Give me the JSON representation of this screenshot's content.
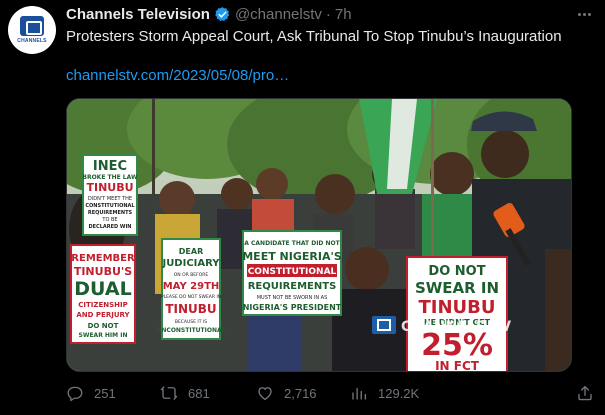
{
  "account": {
    "display_name": "Channels Television",
    "handle": "@channelstv",
    "separator": "·",
    "time": "7h",
    "avatar_label": "CHANNELS"
  },
  "tweet": {
    "text": "Protesters Storm Appeal Court, Ask Tribunal To Stop Tinubu’s Inauguration",
    "link": "channelstv.com/2023/05/08/pro…"
  },
  "media": {
    "watermark": "CHANNELS TV",
    "signs": {
      "inec": [
        "INEC",
        "BROKE THE LAW",
        "TINUBU",
        "DIDN'T MEET THE",
        "CONSTITUTIONAL",
        "REQUIREMENTS",
        "TO BE",
        "DECLARED WIN"
      ],
      "remember": [
        "REMEMBER",
        "TINUBU'S",
        "DUAL",
        "CITIZENSHIP",
        "AND PERJURY",
        "DO NOT",
        "SWEAR HIM IN"
      ],
      "judiciary": [
        "DEAR",
        "JUDICIARY",
        "ON OR BEFORE",
        "MAY 29TH",
        "PLEASE DO NOT SWEAR IN",
        "TINUBU",
        "BECAUSE IT IS",
        "UNCONSTITUTIONAL"
      ],
      "candidate": [
        "A CANDIDATE THAT DID NOT",
        "MEET NIGERIA'S",
        "CONSTITUTIONAL",
        "REQUIREMENTS",
        "MUST NOT BE SWORN IN AS",
        "NIGERIA'S PRESIDENT"
      ],
      "swear": [
        "DO NOT",
        "SWEAR IN",
        "TINUBU",
        "HE DIDN'T GET",
        "25%",
        "IN FCT"
      ]
    }
  },
  "actions": {
    "replies": "251",
    "retweets": "681",
    "likes": "2,716",
    "views": "129.2K"
  },
  "colors": {
    "background": "#000000",
    "text": "#e7e9ea",
    "muted": "#71767b",
    "link": "#1d9bf0",
    "verified": "#1d9bf0"
  }
}
